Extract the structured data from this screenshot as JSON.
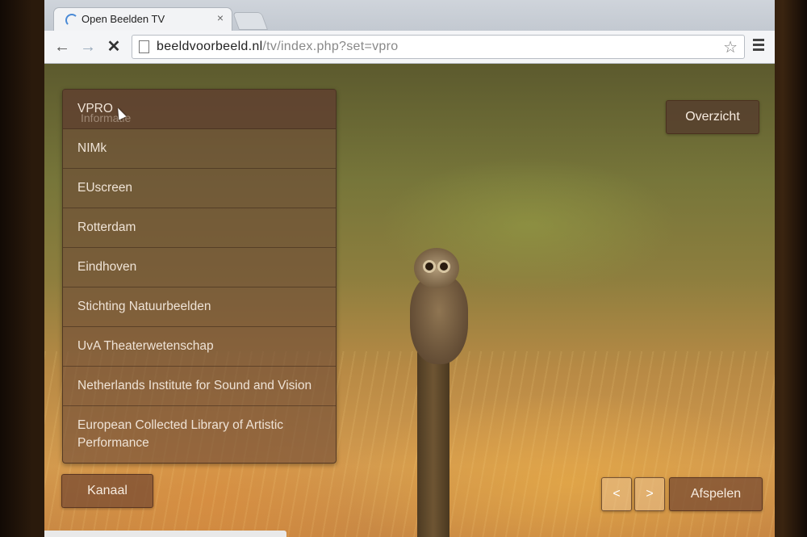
{
  "browser": {
    "tab_title": "Open Beelden TV",
    "tab_close": "×",
    "url_host": "beeldvoorbeeld.nl",
    "url_path": "/tv/index.php?set=vpro",
    "back_glyph": "←",
    "forward_glyph": "→",
    "stop_glyph": "✕",
    "star_glyph": "☆"
  },
  "channels": {
    "ghost_text": "Informatie",
    "items": [
      "VPRO",
      "NIMk",
      "EUscreen",
      "Rotterdam",
      "Eindhoven",
      "Stichting Natuurbeelden",
      "UvA Theaterwetenschap",
      "Netherlands Institute for Sound and Vision",
      "European Collected Library of Artistic Performance"
    ]
  },
  "buttons": {
    "overzicht": "Overzicht",
    "kanaal": "Kanaal",
    "prev": "<",
    "next": ">",
    "afspelen": "Afspelen"
  },
  "colors": {
    "panel": "#6e4b37",
    "button": "#784b32",
    "text": "#efe3d6"
  }
}
